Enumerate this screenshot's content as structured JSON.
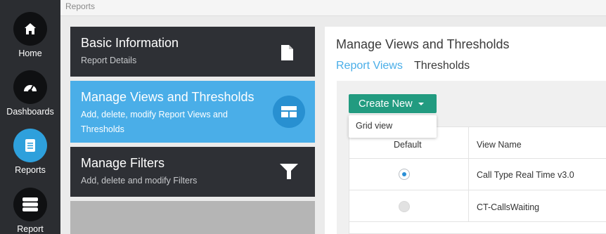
{
  "breadcrumb": "Reports",
  "nav": {
    "items": [
      {
        "label": "Home",
        "icon": "home-icon"
      },
      {
        "label": "Dashboards",
        "icon": "gauge-icon"
      },
      {
        "label": "Reports",
        "icon": "report-icon",
        "active": true
      },
      {
        "label": "Report",
        "icon": "server-icon"
      }
    ]
  },
  "steps": [
    {
      "title": "Basic Information",
      "subtitle": "Report Details",
      "icon": "document-icon"
    },
    {
      "title": "Manage Views and Thresholds",
      "subtitle": "Add, delete, modify Report Views and Thresholds",
      "icon": "layout-icon",
      "active": true
    },
    {
      "title": "Manage Filters",
      "subtitle": "Add, delete and modify Filters",
      "icon": "filter-icon"
    }
  ],
  "panel": {
    "title": "Manage Views and Thresholds",
    "tabs": [
      {
        "label": "Report Views",
        "active": true
      },
      {
        "label": "Thresholds"
      }
    ],
    "create_button": "Create New",
    "dropdown_items": [
      "Grid view"
    ],
    "table": {
      "headers": [
        "Default",
        "View Name"
      ],
      "rows": [
        {
          "view_name": "Call Type Real Time v3.0",
          "default": true
        },
        {
          "view_name": "CT-CallsWaiting",
          "default": false
        }
      ]
    }
  },
  "colors": {
    "nav_bg": "#2b2d31",
    "accent_blue": "#4aaee8",
    "create_green": "#229b80",
    "card_dark": "#2e3035"
  }
}
